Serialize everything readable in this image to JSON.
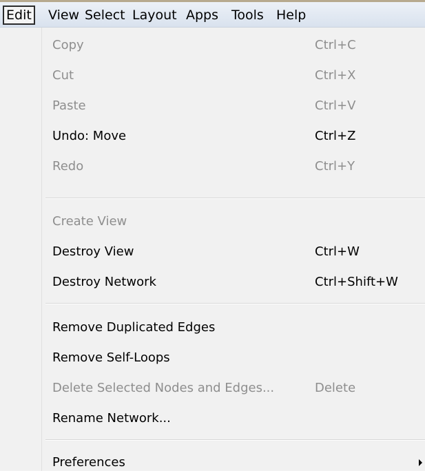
{
  "menubar": {
    "items": [
      {
        "label": "Edit",
        "open": true
      },
      {
        "label": "View"
      },
      {
        "label": "Select"
      },
      {
        "label": "Layout"
      },
      {
        "label": "Apps"
      },
      {
        "label": "Tools"
      },
      {
        "label": "Help"
      }
    ]
  },
  "menu": {
    "groups": [
      [
        {
          "label": "Copy",
          "shortcut": "Ctrl+C",
          "enabled": false
        },
        {
          "label": "Cut",
          "shortcut": "Ctrl+X",
          "enabled": false
        },
        {
          "label": "Paste",
          "shortcut": "Ctrl+V",
          "enabled": false
        },
        {
          "label": "Undo: Move",
          "shortcut": "Ctrl+Z",
          "enabled": true
        },
        {
          "label": "Redo",
          "shortcut": "Ctrl+Y",
          "enabled": false
        }
      ],
      [
        {
          "label": "Create View",
          "shortcut": "",
          "enabled": false
        },
        {
          "label": "Destroy View",
          "shortcut": "Ctrl+W",
          "enabled": true
        },
        {
          "label": "Destroy Network",
          "shortcut": "Ctrl+Shift+W",
          "enabled": true
        }
      ],
      [
        {
          "label": "Remove Duplicated Edges",
          "shortcut": "",
          "enabled": true
        },
        {
          "label": "Remove Self-Loops",
          "shortcut": "",
          "enabled": true
        },
        {
          "label": "Delete Selected Nodes and Edges...",
          "shortcut": "Delete",
          "enabled": false
        },
        {
          "label": "Rename Network...",
          "shortcut": "",
          "enabled": true
        }
      ],
      [
        {
          "label": "Preferences",
          "shortcut": "",
          "enabled": true,
          "submenu": true
        }
      ]
    ]
  },
  "colors": {
    "enabled_text": "#000000",
    "disabled_text": "#8e8e8e",
    "menu_background": "#f1f1f1"
  }
}
